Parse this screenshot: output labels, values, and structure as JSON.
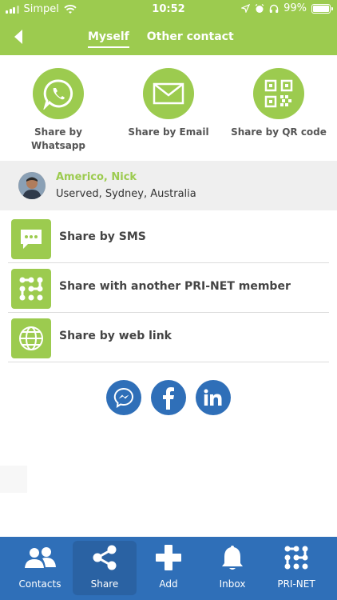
{
  "status_bar": {
    "carrier": "Simpel",
    "time": "10:52",
    "battery": "99%"
  },
  "header": {
    "tabs": [
      {
        "label": "Myself",
        "active": true
      },
      {
        "label": "Other contact",
        "active": false
      }
    ]
  },
  "share_options": [
    {
      "label_line1": "Share by",
      "label_line2": "Whatsapp",
      "icon": "whatsapp-icon"
    },
    {
      "label_line1": "Share by Email",
      "label_line2": "",
      "icon": "email-icon"
    },
    {
      "label_line1": "Share by QR code",
      "label_line2": "",
      "icon": "qr-code-icon"
    }
  ],
  "profile": {
    "name": "Americo, Nick",
    "location": "Userved, Sydney, Australia"
  },
  "list": [
    {
      "label": "Share by SMS",
      "icon": "sms-icon"
    },
    {
      "label": "Share with another PRI-NET member",
      "icon": "pri-net-icon"
    },
    {
      "label": "Share by web link",
      "icon": "globe-icon"
    }
  ],
  "social": [
    "messenger-icon",
    "facebook-icon",
    "linkedin-icon"
  ],
  "bottom_nav": [
    {
      "label": "Contacts",
      "icon": "contacts-icon",
      "active": false
    },
    {
      "label": "Share",
      "icon": "share-icon",
      "active": true
    },
    {
      "label": "Add",
      "icon": "add-icon",
      "active": false
    },
    {
      "label": "Inbox",
      "icon": "bell-icon",
      "active": false
    },
    {
      "label": "PRI-NET",
      "icon": "pri-net-icon",
      "active": false
    }
  ],
  "colors": {
    "brand_green": "#9ccb4f",
    "brand_blue": "#2f6fb8"
  }
}
